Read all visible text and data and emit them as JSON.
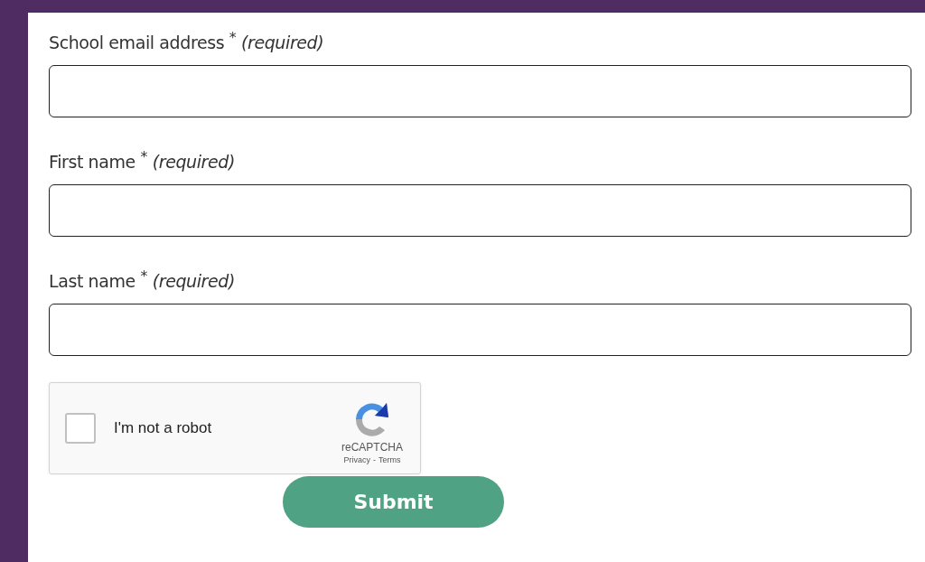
{
  "fields": [
    {
      "label": "School email address $^{*}$ *(required)*"
    },
    {
      "label": "First name $^{*}$ *(required)*"
    },
    {
      "label": "Last name $^{*}$ *(required)*"
    }
  ],
  "captcha": {
    "checked": false,
    "label": "I'm not a robot",
    "brand": "reCAPTCHA",
    "privacy": "Privacy",
    "separator": "-",
    "terms": "Terms"
  },
  "submit": "Submit"
}
